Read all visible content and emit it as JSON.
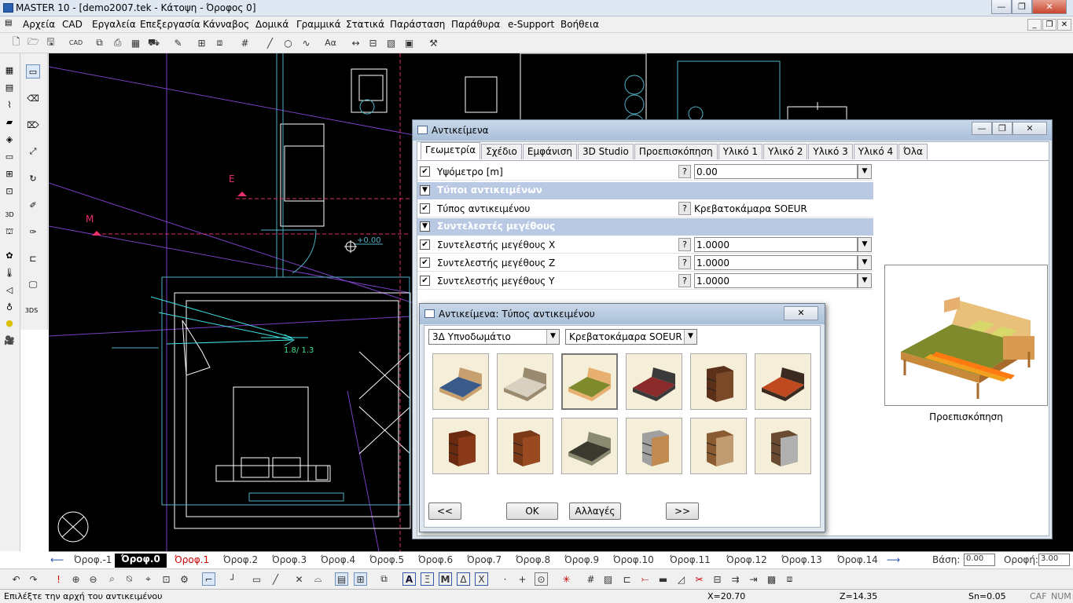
{
  "app": {
    "title": "MASTER 10 - [demo2007.tek - Κάτοψη - Όροφος 0]"
  },
  "window_buttons": {
    "minimize": "—",
    "maximize": "❐",
    "close": "✕"
  },
  "menu": [
    "Αρχεία",
    "CAD",
    "Εργαλεία",
    "Επεξεργασία",
    "Κάνναβος",
    "Δομικά",
    "Γραμμικά",
    "Στατικά",
    "Παράσταση",
    "Παράθυρα",
    "e-Support",
    "Βοήθεια"
  ],
  "mdi_buttons": {
    "min": "_",
    "restore": "❐",
    "close": "✕"
  },
  "canvas": {
    "label_e": "E",
    "label_m": "M",
    "level_text": "+0.00",
    "dim_text": "1.8/   1.3"
  },
  "floors": {
    "tabs": [
      "Όροφ.-1",
      "Όροφ.0",
      "Όροφ.1",
      "Όροφ.2",
      "Όροφ.3",
      "Όροφ.4",
      "Όροφ.5",
      "Όροφ.6",
      "Όροφ.7",
      "Όροφ.8",
      "Όροφ.9",
      "Όροφ.10",
      "Όροφ.11",
      "Όροφ.12",
      "Όροφ.13",
      "Όροφ.14"
    ],
    "active": "Όροφ.0",
    "base_label": "Βάση:",
    "base_value": "0.00",
    "roof_label": "Οροφή:",
    "roof_value": "3.00"
  },
  "status": {
    "prompt": "Επιλέξτε την αρχή του αντικειμένου",
    "x": "X=20.70",
    "z": "Z=14.35",
    "sn": "Sn=0.05",
    "caf": "CAF",
    "num": "NUM"
  },
  "objects_dialog": {
    "title": "Αντικείμενα",
    "tabs": [
      "Γεωμετρία",
      "Σχέδιο",
      "Εμφάνιση",
      "3D Studio",
      "Προεπισκόπηση",
      "Υλικό 1",
      "Υλικό 2",
      "Υλικό 3",
      "Υλικό 4",
      "Όλα"
    ],
    "active_tab": "Γεωμετρία",
    "rows": {
      "altitude": {
        "label": "Υψόμετρο [m]",
        "value": "0.00"
      },
      "types_header": "Τύποι αντικειμένων",
      "object_type": {
        "label": "Τύπος αντικειμένου",
        "value": "Κρεβατοκάμαρα SOEUR"
      },
      "size_header": "Συντελεστές μεγέθους",
      "scale_x": {
        "label": "Συντελεστής μεγέθους X",
        "value": "1.0000"
      },
      "scale_z": {
        "label": "Συντελεστής μεγέθους Z",
        "value": "1.0000"
      },
      "scale_y": {
        "label": "Συντελεστής μεγέθους Y",
        "value": "1.0000"
      }
    },
    "help_mark": "?",
    "check_mark": "✔",
    "preview_label": "Προεπισκόπηση"
  },
  "type_dialog": {
    "title": "Αντικείμενα: Τύπος αντικειμένου",
    "category": "3Δ Υπνοδωμάτιο",
    "item": "Κρεβατοκάμαρα SOEUR",
    "thumbs": [
      "bed-blue",
      "bed-beige",
      "bed-soeur",
      "bed-red",
      "nightstand",
      "bed-slatted",
      "chest-tall",
      "dresser-long",
      "bed-dark",
      "drawers-grey",
      "vanity-mirror",
      "tallboy"
    ],
    "buttons": {
      "prev": "<<",
      "ok": "OK",
      "changes": "Αλλαγές",
      "next": ">>"
    }
  }
}
